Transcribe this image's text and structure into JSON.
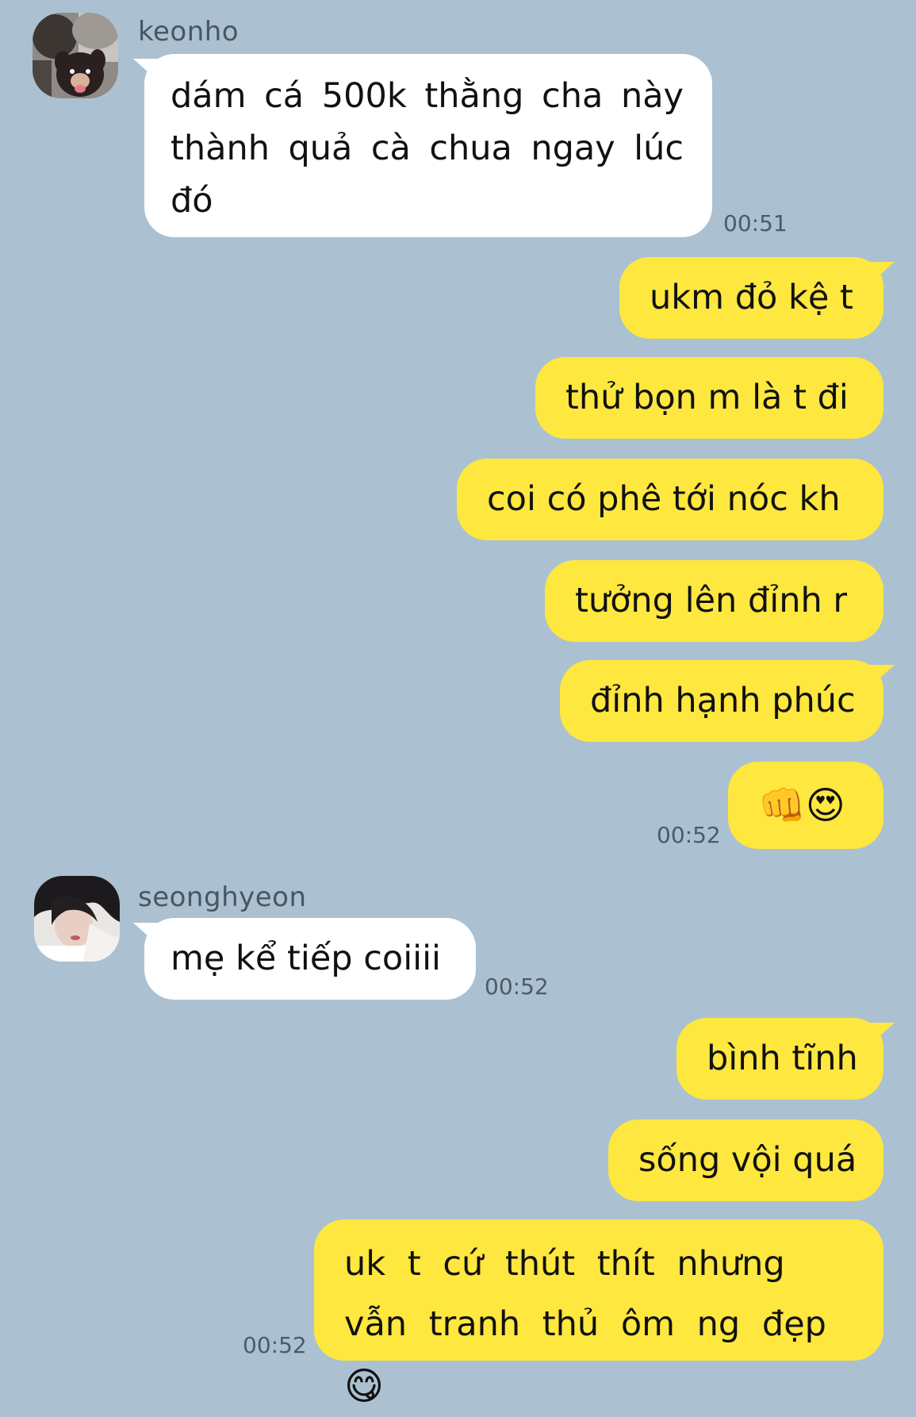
{
  "messages": {
    "m1": {
      "sender": "keonho",
      "text": "dám cá 500k thằng cha này thành quả cà chua ngay lúc đó",
      "time": "00:51"
    },
    "m2": {
      "text": "ukm đỏ kệ t"
    },
    "m3": {
      "text": "thử bọn m là t đi"
    },
    "m4": {
      "text": "coi có phê tới nóc kh"
    },
    "m5": {
      "text": "tưởng lên đỉnh r"
    },
    "m6": {
      "text": "đỉnh hạnh phúc"
    },
    "m7": {
      "emoji_1": "👊",
      "emoji_2": "😍",
      "time": "00:52"
    },
    "m8": {
      "sender": "seonghyeon",
      "text": "mẹ kể tiếp coiiii",
      "time": "00:52"
    },
    "m9": {
      "text": "bình tĩnh"
    },
    "m10": {
      "text": "sống vội quá"
    },
    "m11": {
      "text": "uk t cứ thút thít nhưng vẫn tranh thủ ôm ng đẹp",
      "emoji": "😋",
      "time": "00:52"
    }
  },
  "colors": {
    "background": "#abc1d1",
    "incoming_bubble": "#ffffff",
    "outgoing_bubble": "#fee73f"
  }
}
